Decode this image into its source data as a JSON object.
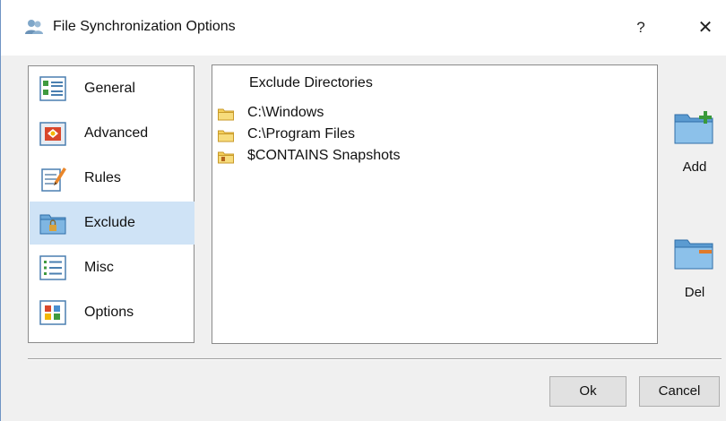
{
  "window": {
    "title": "File Synchronization Options",
    "help_label": "?",
    "close_label": "✕",
    "title_icon": "users-icon"
  },
  "nav": {
    "items": [
      {
        "label": "General",
        "icon": "general-icon",
        "selected": false
      },
      {
        "label": "Advanced",
        "icon": "advanced-icon",
        "selected": false
      },
      {
        "label": "Rules",
        "icon": "rules-icon",
        "selected": false
      },
      {
        "label": "Exclude",
        "icon": "exclude-folder-icon",
        "selected": true
      },
      {
        "label": "Misc",
        "icon": "misc-list-icon",
        "selected": false
      },
      {
        "label": "Options",
        "icon": "options-icon",
        "selected": false
      }
    ]
  },
  "exclude_list": {
    "header": "Exclude Directories",
    "rows": [
      {
        "text": "C:\\Windows",
        "icon": "folder-icon"
      },
      {
        "text": "C:\\Program Files",
        "icon": "folder-icon"
      },
      {
        "text": "$CONTAINS Snapshots",
        "icon": "folder-rule-icon"
      }
    ]
  },
  "actions": {
    "add_label": "Add",
    "del_label": "Del"
  },
  "footer": {
    "ok_label": "Ok",
    "cancel_label": "Cancel"
  },
  "colors": {
    "selection": "#cfe3f6",
    "folder": "#f2c94c",
    "accent_blue": "#3b86c6"
  }
}
